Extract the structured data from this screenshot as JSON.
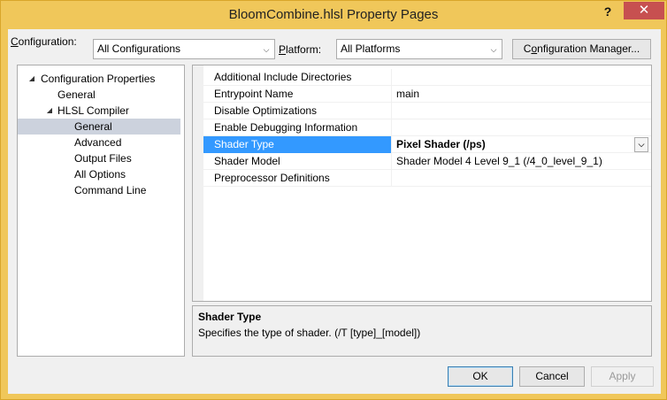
{
  "window": {
    "title": "BloomCombine.hlsl Property Pages",
    "help_label": "?",
    "close_label": "✕"
  },
  "config": {
    "configuration_label_prefix": "C",
    "configuration_label_rest": "onfiguration:",
    "configuration_value": "All Configurations",
    "platform_label_prefix": "P",
    "platform_label_rest": "latform:",
    "platform_value": "All Platforms",
    "manager_prefix": "C",
    "manager_underlined": "o",
    "manager_rest": "nfiguration Manager..."
  },
  "tree": [
    {
      "label": "Configuration Properties",
      "toggle": "◢",
      "selected": false
    },
    {
      "label": "General",
      "toggle": "",
      "selected": false
    },
    {
      "label": "HLSL Compiler",
      "toggle": "◢",
      "selected": false
    },
    {
      "label": "General",
      "toggle": "",
      "selected": true
    },
    {
      "label": "Advanced",
      "toggle": "",
      "selected": false
    },
    {
      "label": "Output Files",
      "toggle": "",
      "selected": false
    },
    {
      "label": "All Options",
      "toggle": "",
      "selected": false
    },
    {
      "label": "Command Line",
      "toggle": "",
      "selected": false
    }
  ],
  "properties": [
    {
      "name": "Additional Include Directories",
      "value": ""
    },
    {
      "name": "Entrypoint Name",
      "value": "main"
    },
    {
      "name": "Disable Optimizations",
      "value": ""
    },
    {
      "name": "Enable Debugging Information",
      "value": ""
    },
    {
      "name": "Shader Type",
      "value": "Pixel Shader (/ps)",
      "selected": true
    },
    {
      "name": "Shader Model",
      "value": "Shader Model 4 Level 9_1 (/4_0_level_9_1)"
    },
    {
      "name": "Preprocessor Definitions",
      "value": ""
    }
  ],
  "description": {
    "title": "Shader Type",
    "text": "Specifies the type of shader.  (/T [type]_[model])"
  },
  "buttons": {
    "ok": "OK",
    "cancel": "Cancel",
    "apply": "Apply"
  },
  "icons": {
    "dropdown": "chevron-down-icon",
    "expand": "tree-expanded-icon"
  },
  "colors": {
    "titlebar": "#f0c75a",
    "selection": "#3399ff",
    "close": "#c75050"
  }
}
